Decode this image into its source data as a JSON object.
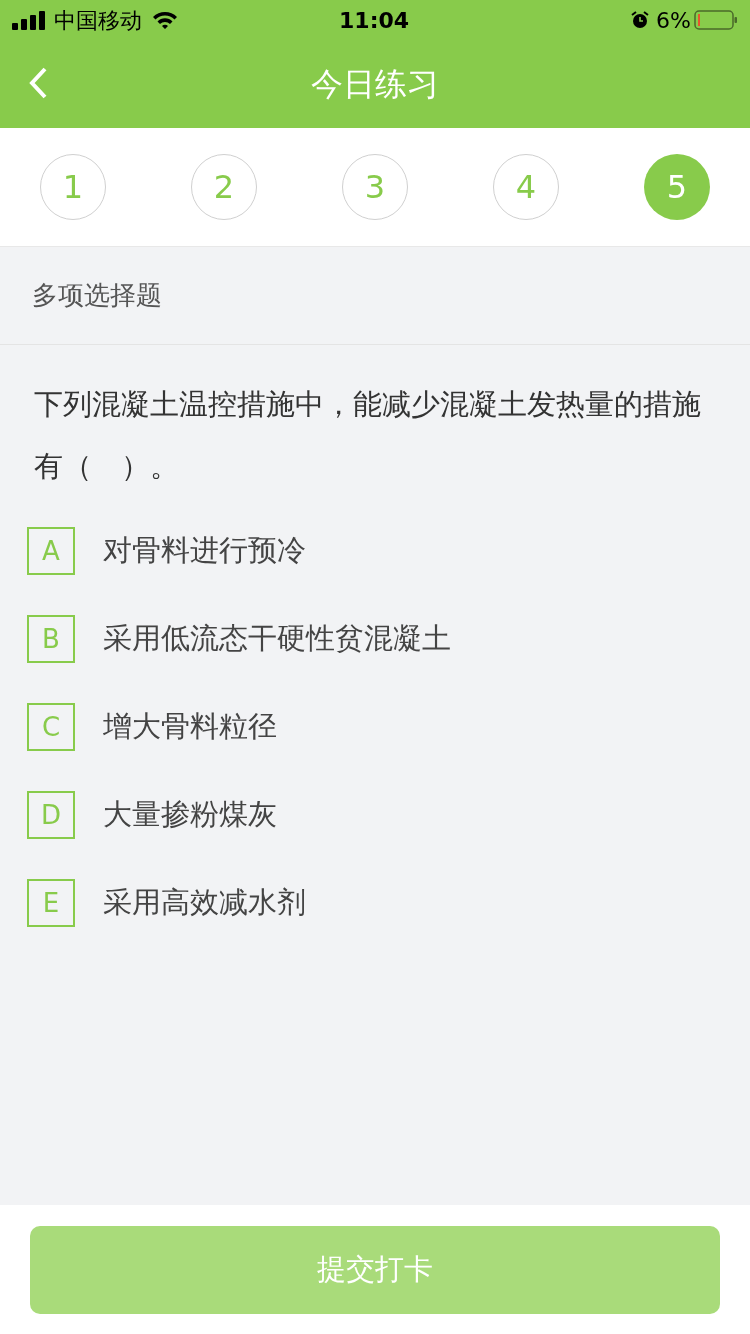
{
  "status_bar": {
    "carrier": "中国移动",
    "time": "11:04",
    "battery": "6%"
  },
  "header": {
    "title": "今日练习"
  },
  "question_nav": [
    {
      "label": "1",
      "selected": false
    },
    {
      "label": "2",
      "selected": false
    },
    {
      "label": "3",
      "selected": false
    },
    {
      "label": "4",
      "selected": false
    },
    {
      "label": "5",
      "selected": true
    }
  ],
  "question_type": "多项选择题",
  "question": "下列混凝土温控措施中，能减少混凝土发热量的措施有（　）。",
  "options": [
    {
      "letter": "A",
      "text": "对骨料进行预冷",
      "selected": false
    },
    {
      "letter": "B",
      "text": "采用低流态干硬性贫混凝土",
      "selected": false
    },
    {
      "letter": "C",
      "text": "增大骨料粒径",
      "selected": false
    },
    {
      "letter": "D",
      "text": "大量掺粉煤灰",
      "selected": false
    },
    {
      "letter": "E",
      "text": "采用高效减水剂",
      "selected": false
    }
  ],
  "submit": {
    "label": "提交打卡",
    "disabled": true
  }
}
